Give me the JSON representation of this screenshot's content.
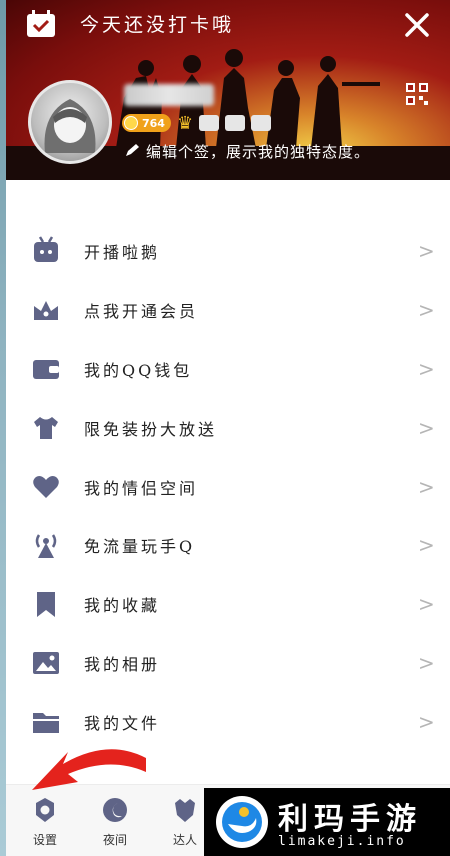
{
  "header": {
    "checkin_text": "今天还没打卡哦",
    "coin_count": "764",
    "signature": "编辑个签，展示我的独特态度。",
    "colors": {
      "banner": "#a21c14",
      "coin": "#f0a11a"
    }
  },
  "menu": {
    "items": [
      {
        "label": "开播啦鹅",
        "icon": "penguin-tv-icon"
      },
      {
        "label": "点我开通会员",
        "icon": "crown-icon"
      },
      {
        "label": "我的QQ钱包",
        "icon": "wallet-icon"
      },
      {
        "label": "限免装扮大放送",
        "icon": "tshirt-icon"
      },
      {
        "label": "我的情侣空间",
        "icon": "heart-icon"
      },
      {
        "label": "免流量玩手Q",
        "icon": "signal-tower-icon"
      },
      {
        "label": "我的收藏",
        "icon": "bookmark-icon"
      },
      {
        "label": "我的相册",
        "icon": "photo-icon"
      },
      {
        "label": "我的文件",
        "icon": "folder-icon"
      }
    ],
    "chevron": ">"
  },
  "bottom_bar": {
    "settings_label": "设置",
    "night_label": "夜间",
    "expert_label": "达人"
  },
  "watermark": {
    "title": "利玛手游",
    "url": "limakeji.info"
  }
}
